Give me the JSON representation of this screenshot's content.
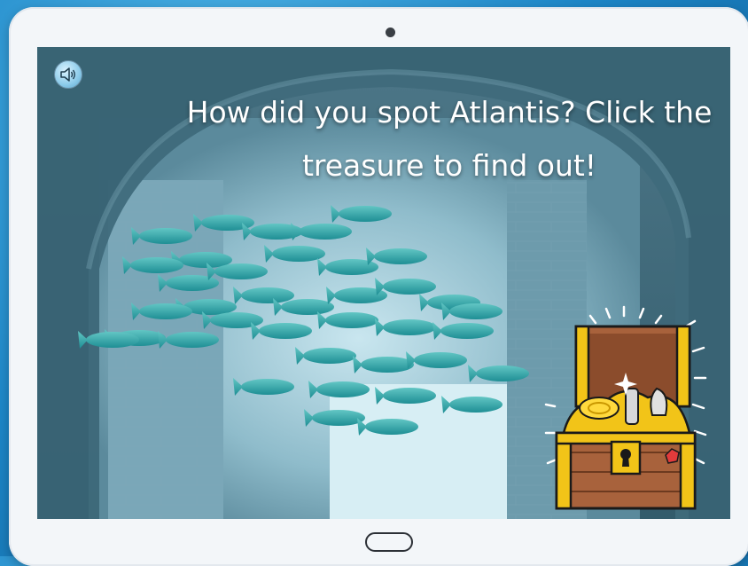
{
  "device": {
    "type": "tablet"
  },
  "scene": {
    "background": "underwater stone archway with school of fish",
    "prompt": "How did you spot Atlantis? Click the treasure to find out!"
  },
  "controls": {
    "sound_icon": "speaker-icon",
    "treasure_icon": "treasure-chest-icon"
  },
  "colors": {
    "frame_bg": "#1d86c7",
    "tablet": "#f3f6f9",
    "water": "#4e7f92",
    "fish": "#2fa7a8",
    "chest_wood": "#a8623c",
    "gold": "#f2c418"
  }
}
